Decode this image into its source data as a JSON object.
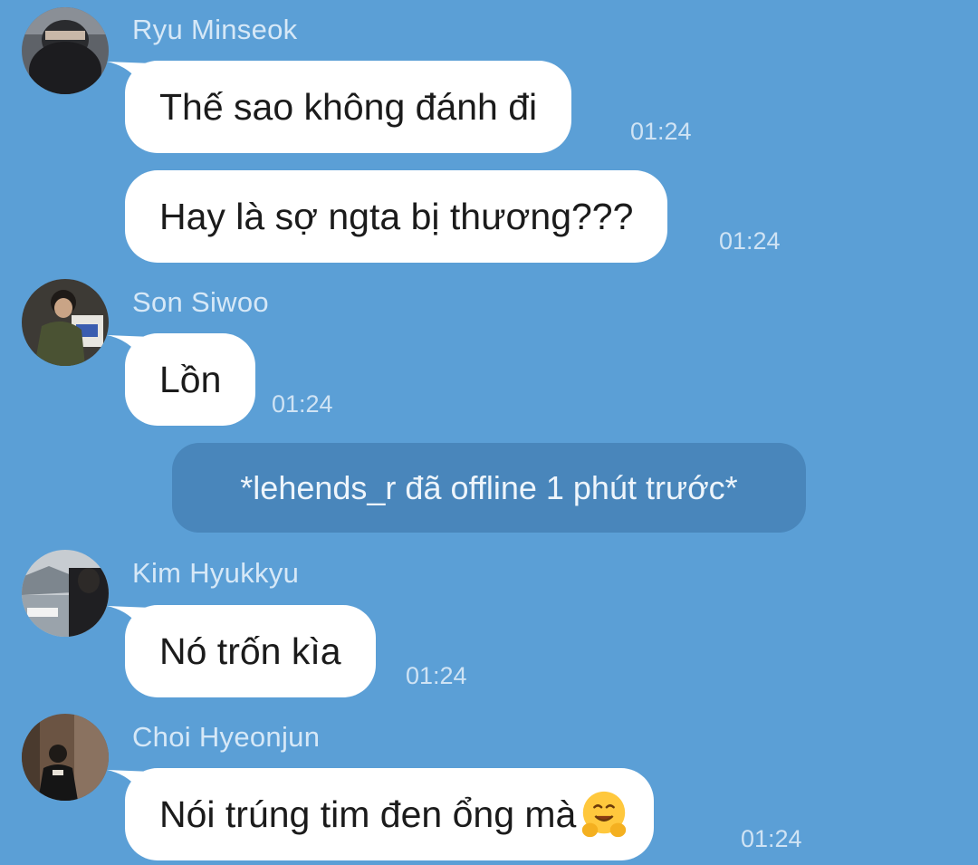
{
  "chat": {
    "messages": [
      {
        "sender": "Ryu Minseok",
        "avatar": "avatar-ryu-minseok",
        "text": "Thế sao không đánh đi",
        "time": "01:24"
      },
      {
        "text": "Hay là sợ ngta bị thương???",
        "time": "01:24"
      },
      {
        "sender": "Son Siwoo",
        "avatar": "avatar-son-siwoo",
        "text": "Lồn",
        "time": "01:24"
      },
      {
        "system": "*lehends_r đã offline 1 phút trước*"
      },
      {
        "sender": "Kim Hyukkyu",
        "avatar": "avatar-kim-hyukkyu",
        "text": "Nó trốn kìa",
        "time": "01:24"
      },
      {
        "sender": "Choi Hyeonjun",
        "avatar": "avatar-choi-hyeonjun",
        "text": "Nói trúng tim đen ổng mà",
        "emoji": "hugging-face-icon",
        "time": "01:24"
      }
    ]
  },
  "colors": {
    "background": "#5b9fd6",
    "bubble": "#ffffff",
    "system_bubble": "#4986bb",
    "sender_name": "#d6e8f7",
    "timestamp": "#cfe3f4"
  }
}
